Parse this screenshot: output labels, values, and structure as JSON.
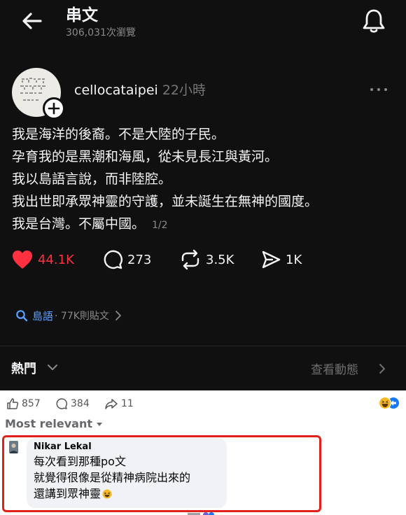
{
  "threads": {
    "header": {
      "title": "串文",
      "views": "306,031次瀏覽",
      "back_icon": "arrow-left-icon",
      "bell_icon": "bell-icon"
    },
    "post": {
      "username": "cellocataipei",
      "time": "22小時",
      "lines": [
        "我是海洋的後裔。不是大陸的子民。",
        "孕育我的是黑潮和海風，從未見長江與黃河。",
        "我以島語言說，而非陸腔。",
        "我出世即承眾神靈的守護，並未誕生在無神的國度。",
        "我是台灣。不屬中國。"
      ],
      "page_indicator": "1/2",
      "actions": {
        "likes": "44.1K",
        "comments": "273",
        "reposts": "3.5K",
        "shares": "1K"
      },
      "topic": {
        "name": "島語",
        "meta": "· 77K則貼文"
      }
    },
    "hot": {
      "label": "熱門",
      "activity": "查看動態"
    },
    "colors": {
      "background": "#101010",
      "like": "#ff3040",
      "topic": "#5aa0ff"
    }
  },
  "facebook": {
    "stats": {
      "likes": "857",
      "comments": "384",
      "shares": "11"
    },
    "sort_label": "Most relevant",
    "comment": {
      "author": "Nikar Lekal",
      "lines": [
        "每次看到那種po文",
        "就覺得很像是從精神病院出來的",
        "還講到眾神靈"
      ]
    },
    "colors": {
      "highlight": "#e0201a",
      "bubble": "#f0f2f5"
    }
  }
}
